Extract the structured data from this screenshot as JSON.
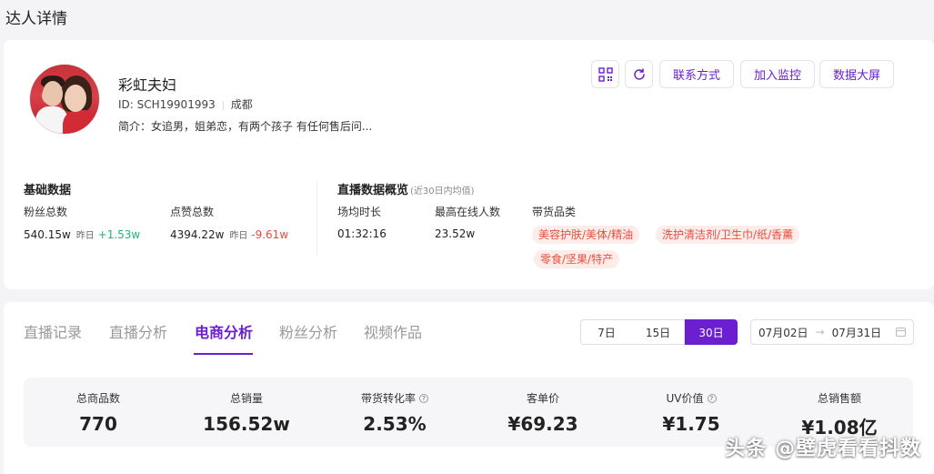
{
  "page": {
    "title": "达人详情"
  },
  "profile": {
    "name": "彩虹夫妇",
    "id_label": "ID: SCH19901993",
    "location": "成都",
    "bio": "简介：女追男，姐弟恋，有两个孩子 有任何售后问...",
    "actions": {
      "contact": "联系方式",
      "monitor": "加入监控",
      "screen": "数据大屏"
    }
  },
  "basic_data": {
    "title": "基础数据",
    "fans": {
      "label": "粉丝总数",
      "value": "540.15w",
      "yday_label": "昨日",
      "change": "+1.53w"
    },
    "likes": {
      "label": "点赞总数",
      "value": "4394.22w",
      "yday_label": "昨日",
      "change": "-9.61w"
    }
  },
  "live_overview": {
    "title": "直播数据概览",
    "subtitle": "(近30日内均值)",
    "duration": {
      "label": "场均时长",
      "value": "01:32:16"
    },
    "peak_online": {
      "label": "最高在线人数",
      "value": "23.52w"
    },
    "categories_label": "带货品类",
    "categories": [
      "美容护肤/美体/精油",
      "洗护清洁剂/卫生巾/纸/香薰",
      "零食/坚果/特产"
    ]
  },
  "tabs": [
    "直播记录",
    "直播分析",
    "电商分析",
    "粉丝分析",
    "视频作品"
  ],
  "active_tab": "电商分析",
  "ranges": [
    "7日",
    "15日",
    "30日"
  ],
  "active_range": "30日",
  "date_range": {
    "start": "07月02日",
    "arrow": "→",
    "end": "07月31日"
  },
  "stats": [
    {
      "label": "总商品数",
      "value": "770",
      "help": false
    },
    {
      "label": "总销量",
      "value": "156.52w",
      "help": false
    },
    {
      "label": "带货转化率",
      "value": "2.53%",
      "help": true
    },
    {
      "label": "客单价",
      "value": "¥69.23",
      "help": false
    },
    {
      "label": "UV价值",
      "value": "¥1.75",
      "help": true
    },
    {
      "label": "总销售额",
      "value": "¥1.08亿",
      "help": false
    }
  ],
  "watermark": "头条 @壁虎看看抖数",
  "colors": {
    "accent": "#6b1fd1",
    "up": "#22b573",
    "down": "#f0483e",
    "tag_bg": "#fdecea",
    "tag_text": "#e5503f"
  }
}
